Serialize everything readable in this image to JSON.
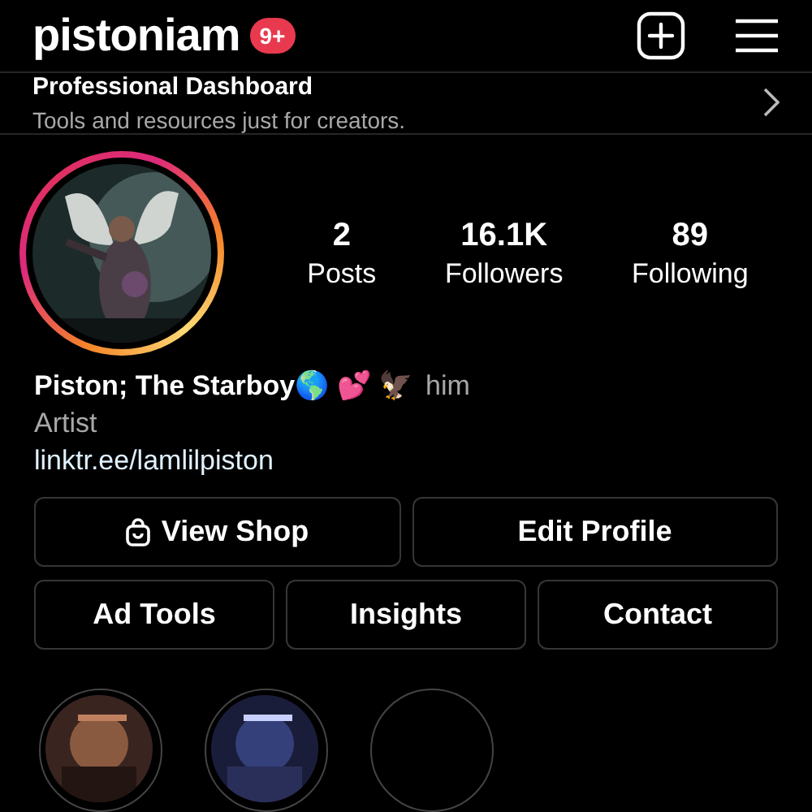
{
  "header": {
    "username": "pistoniam",
    "badge": "9+"
  },
  "dashboard": {
    "title": "Professional Dashboard",
    "subtitle": "Tools and resources just for creators."
  },
  "stats": [
    {
      "value": "2",
      "label": "Posts"
    },
    {
      "value": "16.1K",
      "label": "Followers"
    },
    {
      "value": "89",
      "label": "Following"
    }
  ],
  "bio": {
    "name": "Piston; The Starboy🌎 💕 🦅",
    "pronouns": "him",
    "category": "Artist",
    "link": "linktr.ee/lamlilpiston"
  },
  "buttons": [
    [
      {
        "label": "View Shop",
        "kind": "shop"
      },
      {
        "label": "Edit Profile",
        "kind": "plain"
      }
    ],
    [
      {
        "label": "Ad Tools",
        "kind": "plain"
      },
      {
        "label": "Insights",
        "kind": "plain"
      },
      {
        "label": "Contact",
        "kind": "plain"
      }
    ]
  ],
  "highlights": [
    {
      "kind": "picture"
    },
    {
      "kind": "picture"
    },
    {
      "kind": "empty"
    }
  ]
}
